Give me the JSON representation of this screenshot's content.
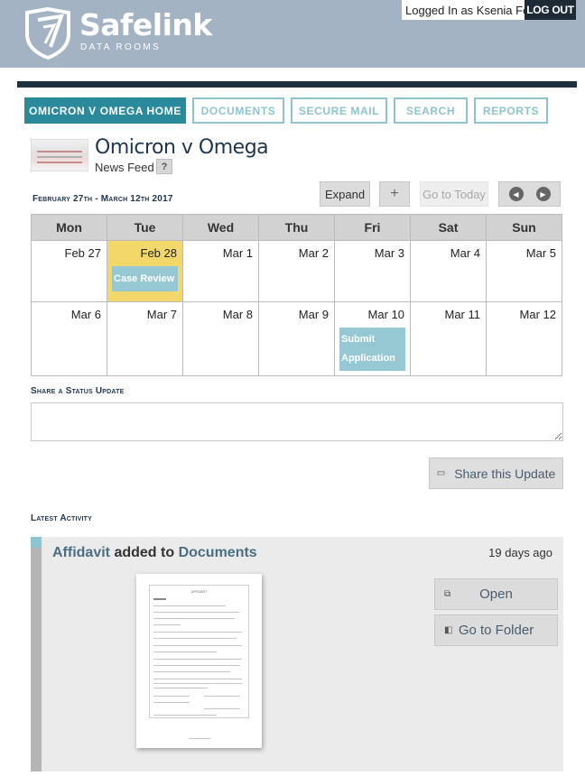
{
  "header": {
    "brand": "Safelink",
    "brand_sub": "DATA ROOMS",
    "logged_in_text": "Logged In as Ksenia Ford.",
    "logout_label": "LOG OUT"
  },
  "tabs": [
    {
      "label": "OMICRON V OMEGA HOME",
      "active": true
    },
    {
      "label": "DOCUMENTS",
      "active": false
    },
    {
      "label": "SECURE MAIL",
      "active": false
    },
    {
      "label": "SEARCH",
      "active": false
    },
    {
      "label": "REPORTS",
      "active": false
    }
  ],
  "room": {
    "title": "Omicron v Omega",
    "subtitle": "News Feed",
    "help": "?"
  },
  "calendar": {
    "range": "February 27th - March 12th 2017",
    "controls": {
      "expand": "Expand",
      "add": "+",
      "today": "Go to Today",
      "prev": "◀",
      "next": "▶"
    },
    "days": [
      "Mon",
      "Tue",
      "Wed",
      "Thu",
      "Fri",
      "Sat",
      "Sun"
    ],
    "week1": [
      "Feb 27",
      "Feb 28",
      "Mar 1",
      "Mar 2",
      "Mar 3",
      "Mar 4",
      "Mar 5"
    ],
    "week2": [
      "Mar 6",
      "Mar 7",
      "Mar 8",
      "Mar 9",
      "Mar 10",
      "Mar 11",
      "Mar 12"
    ],
    "events": {
      "case_review": "Case Review",
      "submit_application": "Submit Application"
    },
    "today_color": "#f2d86a",
    "event_color": "#96c8d3"
  },
  "status": {
    "label": "Share a Status Update",
    "share_label": "Share this Update"
  },
  "activity": {
    "label": "Latest Activity",
    "item": {
      "doc_name": "Affidavit",
      "verb": "added to",
      "folder": "Documents",
      "time": "19 days ago",
      "open_label": "Open",
      "folder_label": "Go to Folder",
      "doc_heading": "AFFIDAVIT"
    }
  },
  "colors": {
    "accent": "#2a8a9b",
    "header_bg": "#a4b3c4",
    "navy": "#1e2f3f"
  }
}
